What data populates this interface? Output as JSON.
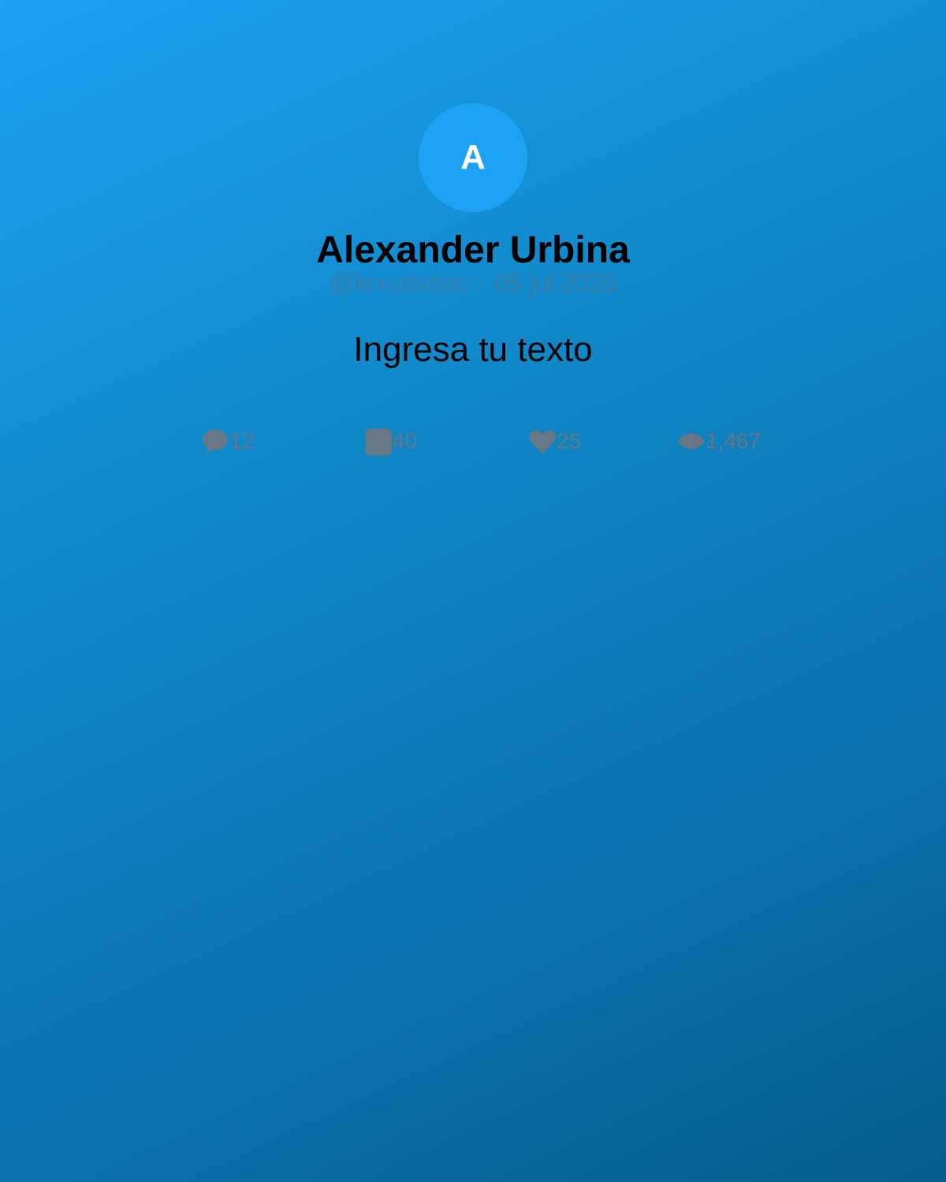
{
  "tweet": {
    "avatar_initial": "A",
    "display_name": "Alexander Urbina",
    "handle": "@lexurbinac",
    "separator": "·",
    "date": "05 jul 2025",
    "text": "Ingresa tu texto"
  },
  "stats": {
    "replies": {
      "icon": "comment-icon",
      "count": "12"
    },
    "retweets": {
      "icon": "retweet-icon",
      "count": "40"
    },
    "likes": {
      "icon": "heart-icon",
      "count": "25"
    },
    "views": {
      "icon": "eye-icon",
      "count": "1,467"
    }
  },
  "colors": {
    "background_start": "#1da1f2",
    "background_end": "#085a8c",
    "avatar_bg": "#1da1f2",
    "stat_gray": "#687786"
  }
}
